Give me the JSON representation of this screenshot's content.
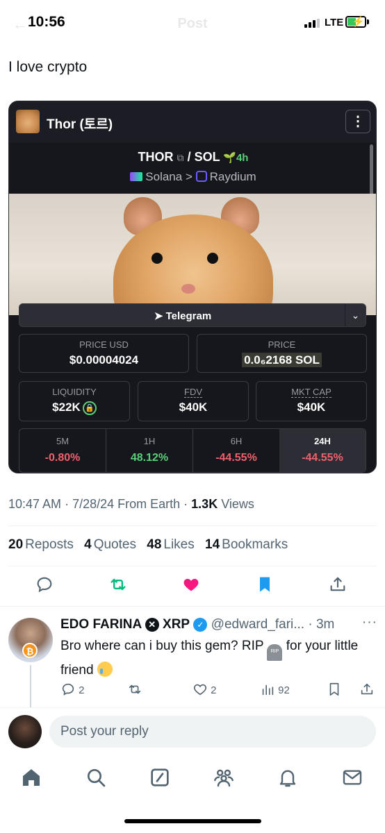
{
  "status_bar": {
    "time": "10:56",
    "network": "LTE"
  },
  "header": {
    "title": "Post"
  },
  "post": {
    "text": "I love crypto",
    "embedded_screenshot": {
      "token_name": "Thor (토르)",
      "pair_base": "THOR",
      "pair_quote": "/ SOL",
      "age": "4h",
      "chain": "Solana",
      "separator": ">",
      "dex": "Raydium",
      "telegram_label": "Telegram",
      "price_usd": {
        "label": "PRICE USD",
        "value": "$0.00004024"
      },
      "price": {
        "label": "PRICE",
        "value": "0.0₆2168 SOL"
      },
      "liquidity": {
        "label": "LIQUIDITY",
        "value": "$22K"
      },
      "fdv": {
        "label": "FDV",
        "value": "$40K"
      },
      "mkt_cap": {
        "label": "MKT CAP",
        "value": "$40K"
      },
      "changes": [
        {
          "label": "5M",
          "value": "-0.80%"
        },
        {
          "label": "1H",
          "value": "48.12%"
        },
        {
          "label": "6H",
          "value": "-44.55%"
        },
        {
          "label": "24H",
          "value": "-44.55%"
        }
      ]
    },
    "time": "10:47 AM",
    "date": "7/28/24",
    "source": "From Earth",
    "views_count": "1.3K",
    "views_label": "Views",
    "reposts_count": "20",
    "reposts_label": "Reposts",
    "quotes_count": "4",
    "quotes_label": "Quotes",
    "likes_count": "48",
    "likes_label": "Likes",
    "bookmarks_count": "14",
    "bookmarks_label": "Bookmarks"
  },
  "reply": {
    "name": "EDO FARINA",
    "name_suffix": "XRP",
    "handle": "@edward_fari...",
    "age": "3m",
    "text_before": "Bro where can i buy this gem? RIP",
    "text_after": "for your little friend",
    "replies": "2",
    "likes": "2",
    "views": "92"
  },
  "composer": {
    "placeholder": "Post your reply"
  },
  "colors": {
    "like": "#f91880",
    "repost": "#00ba7c",
    "bookmark": "#1d9bf0",
    "negative": "#f0616d",
    "positive": "#5ad07a"
  },
  "icons": [
    "reply-icon",
    "repost-icon",
    "like-icon",
    "bookmark-icon",
    "share-icon",
    "home-icon",
    "search-icon",
    "grok-icon",
    "communities-icon",
    "notifications-icon",
    "messages-icon"
  ]
}
